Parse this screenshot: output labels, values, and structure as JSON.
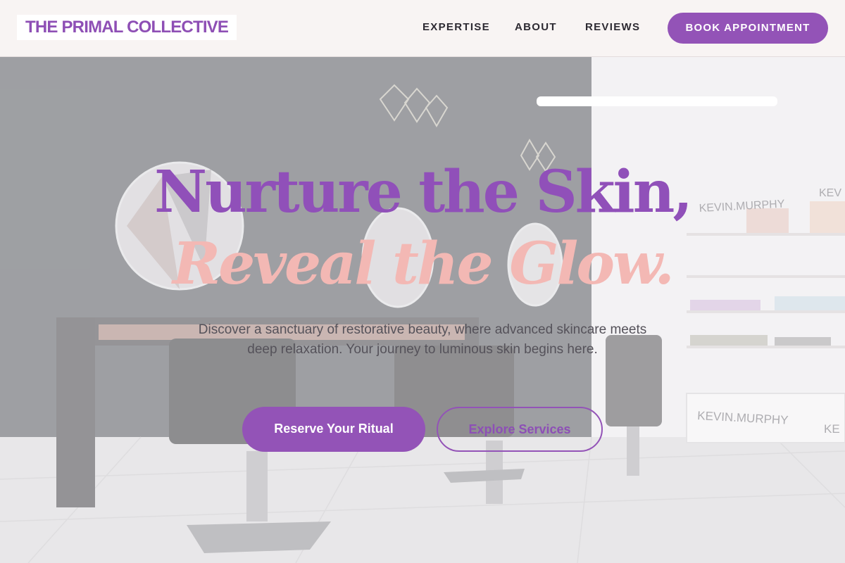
{
  "header": {
    "logo": "THE PRIMAL COLLECTIVE",
    "nav": {
      "expertise": "EXPERTISE",
      "about": "ABOUT",
      "reviews": "REVIEWS"
    },
    "book_label": "BOOK APPOINTMENT"
  },
  "hero": {
    "headline_line1": "Nurture the Skin,",
    "headline_line2": "Reveal the Glow.",
    "subtitle": "Discover a sanctuary of restorative beauty, where advanced skincare meets deep relaxation. Your journey to luminous skin begins here.",
    "primary_cta": "Reserve Your Ritual",
    "secondary_cta": "Explore Services",
    "background": {
      "shelf_brand": "KEVIN.MURPHY",
      "shelf_brand_partial": "KEV",
      "counter_brand_partial": "KE"
    }
  },
  "colors": {
    "accent_purple": "#9353b7",
    "accent_pink": "#f3b8b4",
    "header_bg": "#f8f4f3",
    "body_text": "#55525a"
  }
}
